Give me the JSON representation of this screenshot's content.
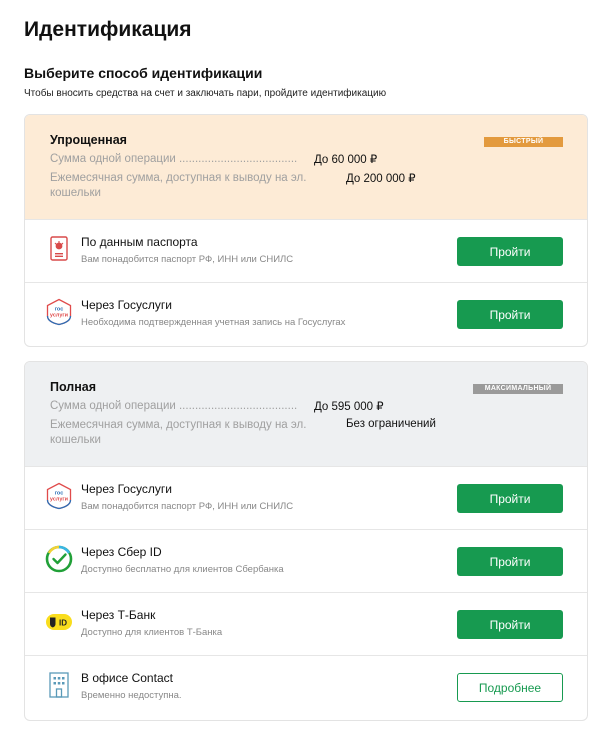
{
  "page": {
    "title": "Идентификация",
    "section_title": "Выберите способ идентификации",
    "section_subtitle": "Чтобы вносить средства на счет и заключать пари, пройдите идентификацию"
  },
  "levels": [
    {
      "title": "Упрощенная",
      "badge": "БЫСТРЫЙ",
      "rows": [
        {
          "label": "Сумма одной операции .....................................",
          "value": "До 60 000 ₽"
        },
        {
          "label": "Ежемесячная сумма, доступная к выводу на эл. кошельки",
          "value": "До 200 000 ₽"
        }
      ],
      "methods": [
        {
          "title": "По данным паспорта",
          "desc": "Вам понадобится паспорт РФ, ИНН или СНИЛС",
          "button": "Пройти",
          "icon": "passport-icon"
        },
        {
          "title": "Через Госуслуги",
          "desc": "Необходима подтвержденная учетная запись на Госуслугах",
          "button": "Пройти",
          "icon": "gosuslugi-icon"
        }
      ]
    },
    {
      "title": "Полная",
      "badge": "МАКСИМАЛЬНЫЙ",
      "rows": [
        {
          "label": "Сумма одной операции .....................................",
          "value": "До 595 000 ₽"
        },
        {
          "label": "Ежемесячная сумма, доступная к выводу на эл. кошельки",
          "value": "Без ограничений"
        }
      ],
      "methods": [
        {
          "title": "Через Госуслуги",
          "desc": "Вам понадобится паспорт РФ, ИНН или СНИЛС",
          "button": "Пройти",
          "icon": "gosuslugi-icon"
        },
        {
          "title": "Через Сбер ID",
          "desc": "Доступно бесплатно для клиентов Сбербанка",
          "button": "Пройти",
          "icon": "sber-id-icon"
        },
        {
          "title": "Через Т-Банк",
          "desc": "Доступно для клиентов Т-Банка",
          "button": "Пройти",
          "icon": "tbank-id-icon"
        },
        {
          "title": "В офисе Contact",
          "desc": "Временно недоступна.",
          "button": "Подробнее",
          "icon": "office-building-icon"
        }
      ]
    }
  ],
  "icon_text": {
    "gos_line1": "гос",
    "gos_line2": "услуги",
    "tbank_id": "ID"
  },
  "colors": {
    "accent_green": "#179a50",
    "simple_header_bg": "#fdebd6",
    "full_header_bg": "#eef0f2",
    "badge_fast": "#e39a3e",
    "badge_max": "#9a9a9a"
  }
}
